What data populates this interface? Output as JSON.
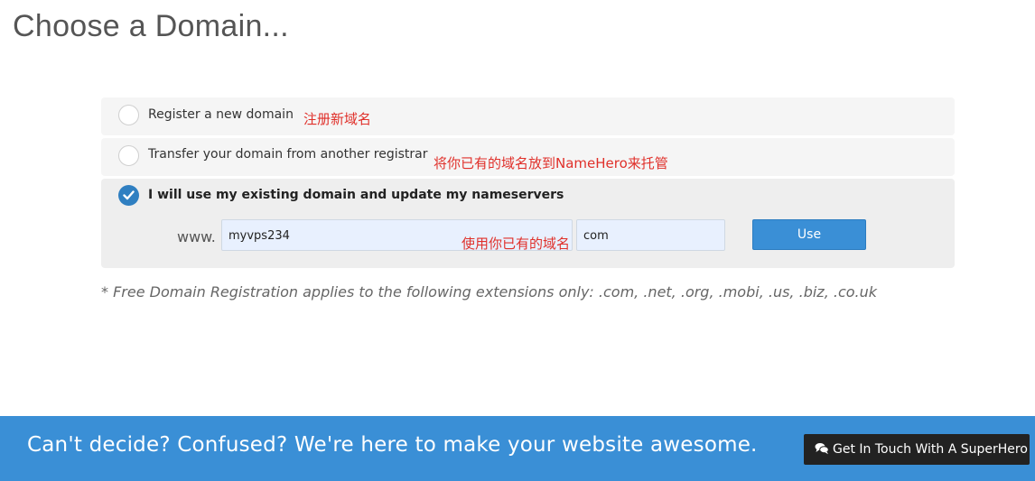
{
  "page": {
    "title": "Choose a Domain..."
  },
  "options": [
    {
      "label": "Register a new domain",
      "selected": false,
      "annotation": "注册新域名"
    },
    {
      "label": "Transfer your domain from another registrar",
      "selected": false,
      "annotation": "将你已有的域名放到NameHero来托管"
    },
    {
      "label": "I will use my existing domain and update my nameservers",
      "selected": true,
      "annotation": "使用你已有的域名"
    }
  ],
  "existing_domain": {
    "prefix": "www.",
    "domain_value": "myvps234",
    "tld_value": "com",
    "use_label": "Use"
  },
  "footnote": "* Free Domain Registration applies to the following extensions only: .com, .net, .org, .mobi, .us, .biz, .co.uk",
  "cta": {
    "text": "Can't decide? Confused? We're here to make your website awesome.",
    "button_label": "Get In Touch With A SuperHero",
    "button_icon": "comments-icon"
  },
  "colors": {
    "accent": "#3a8fd6",
    "annotation": "#e0302a",
    "cta_button": "#222222"
  }
}
